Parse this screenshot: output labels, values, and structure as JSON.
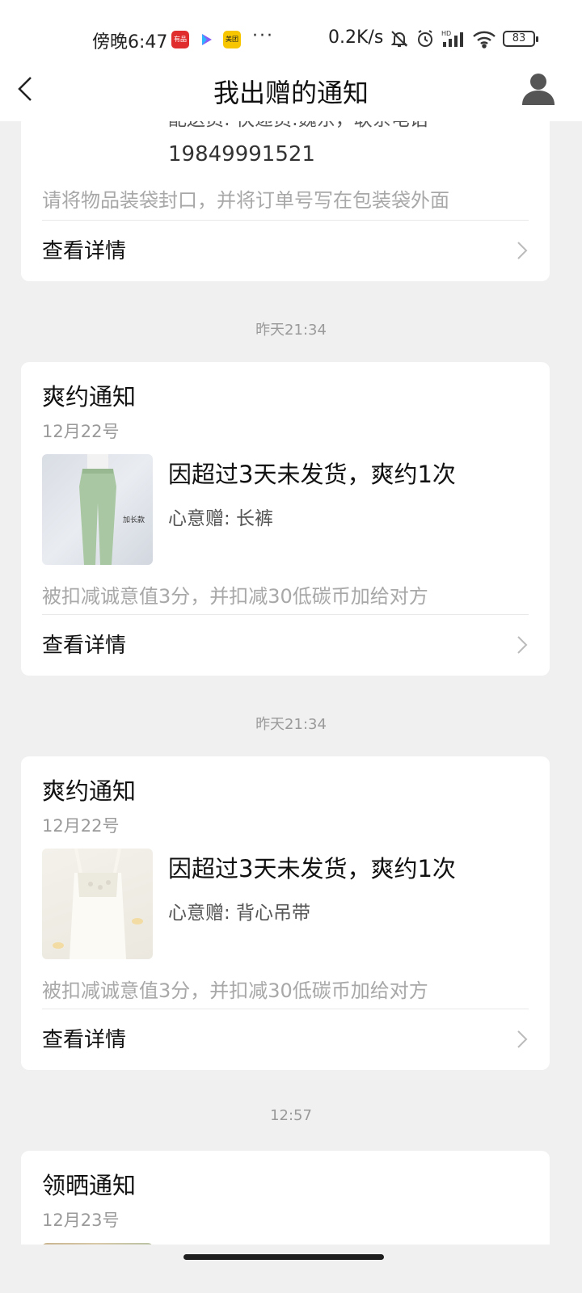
{
  "status_bar": {
    "time": "傍晚6:47",
    "more": "···",
    "net_speed": "0.2K/s",
    "battery": "83",
    "apps": [
      {
        "name": "app-badge-red",
        "label": "有品",
        "color": "#e02e2e"
      },
      {
        "name": "app-badge-play",
        "label": "",
        "color": "#ffffff"
      },
      {
        "name": "app-badge-meituan",
        "label": "美团",
        "color": "#f7c600"
      }
    ]
  },
  "header": {
    "title": "我出赠的通知"
  },
  "card0": {
    "courier_line": "配送员: 快递员:魏东，联系电话",
    "phone": "19849991521",
    "note": "请将物品装袋封口，并将订单号写在包装袋外面",
    "detail_label": "查看详情"
  },
  "notifications": [
    {
      "time": "昨天21:34",
      "title": "爽约通知",
      "date": "12月22号",
      "headline": "因超过3天未发货，爽约1次",
      "gift_line": "心意赠: 长裤",
      "thumb_caption": "加长款",
      "note": "被扣减诚意值3分，并扣减30低碳币加给对方",
      "detail_label": "查看详情"
    },
    {
      "time": "昨天21:34",
      "title": "爽约通知",
      "date": "12月22号",
      "headline": "因超过3天未发货，爽约1次",
      "gift_line": "心意赠: 背心吊带",
      "note": "被扣减诚意值3分，并扣减30低碳币加给对方",
      "detail_label": "查看详情"
    },
    {
      "time": "12:57",
      "title": "领晒通知",
      "date": "12月23号"
    }
  ],
  "colors": {
    "background": "#f0f0f0",
    "card": "#ffffff",
    "muted_text": "#9a9a9a"
  }
}
